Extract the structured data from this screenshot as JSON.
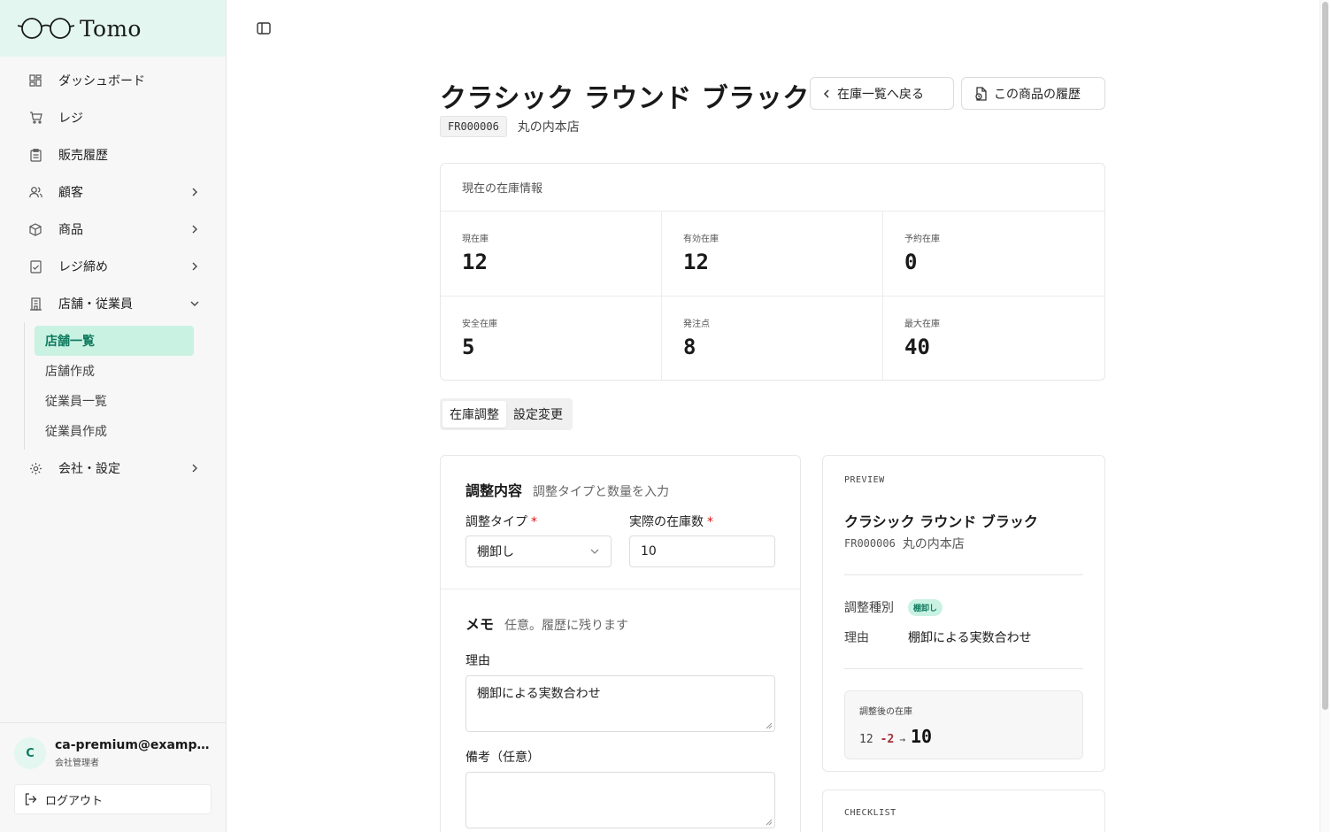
{
  "app": {
    "logo_text": "Tomo"
  },
  "sidebar": {
    "items": [
      {
        "label": "ダッシュボード",
        "icon": "dashboard-icon"
      },
      {
        "label": "レジ",
        "icon": "cart-icon"
      },
      {
        "label": "販売履歴",
        "icon": "clipboard-icon"
      },
      {
        "label": "顧客",
        "icon": "users-icon"
      },
      {
        "label": "商品",
        "icon": "box-icon"
      },
      {
        "label": "レジ締め",
        "icon": "clipboard-check-icon"
      },
      {
        "label": "店舗・従業員",
        "icon": "building-icon"
      },
      {
        "label": "会社・設定",
        "icon": "gear-icon"
      }
    ],
    "sub_items": [
      {
        "label": "店舗一覧",
        "active": true
      },
      {
        "label": "店舗作成"
      },
      {
        "label": "従業員一覧"
      },
      {
        "label": "従業員作成"
      }
    ],
    "user": {
      "initial": "C",
      "email": "ca-premium@example.com",
      "role": "会社管理者"
    },
    "logout_label": "ログアウト"
  },
  "header": {
    "title": "クラシック ラウンド ブラック",
    "back_label": "在庫一覧へ戻る",
    "history_label": "この商品の履歴",
    "code": "FR000006",
    "store": "丸の内本店"
  },
  "stock": {
    "heading": "現在の在庫情報",
    "stats": [
      {
        "label": "現在庫",
        "value": "12"
      },
      {
        "label": "有効在庫",
        "value": "12"
      },
      {
        "label": "予約在庫",
        "value": "0"
      },
      {
        "label": "安全在庫",
        "value": "5"
      },
      {
        "label": "発注点",
        "value": "8"
      },
      {
        "label": "最大在庫",
        "value": "40"
      }
    ]
  },
  "tabs": [
    {
      "label": "在庫調整",
      "active": true
    },
    {
      "label": "設定変更"
    }
  ],
  "form": {
    "adjust_title": "調整内容",
    "adjust_sub": "調整タイプと数量を入力",
    "type_label": "調整タイプ",
    "type_value": "棚卸し",
    "qty_label": "実際の在庫数",
    "qty_value": "10",
    "memo_title": "メモ",
    "memo_sub": "任意。履歴に残ります",
    "reason_label": "理由",
    "reason_value": "棚卸による実数合わせ",
    "notes_label": "備考（任意）",
    "notes_value": ""
  },
  "preview": {
    "label": "PREVIEW",
    "title": "クラシック ラウンド ブラック",
    "code": "FR000006",
    "store": "丸の内本店",
    "type_key": "調整種別",
    "type_badge": "棚卸し",
    "reason_key": "理由",
    "reason_value": "棚卸による実数合わせ",
    "after_label": "調整後の在庫",
    "from": "12",
    "diff": "-2",
    "arrow": "→",
    "to": "10"
  },
  "checklist": {
    "label": "CHECKLIST"
  },
  "colors": {
    "accent": "#0e7a5e",
    "accent_bg": "#c9f2e3",
    "logo_bg": "#e3f7f0",
    "required": "#dd1111"
  }
}
